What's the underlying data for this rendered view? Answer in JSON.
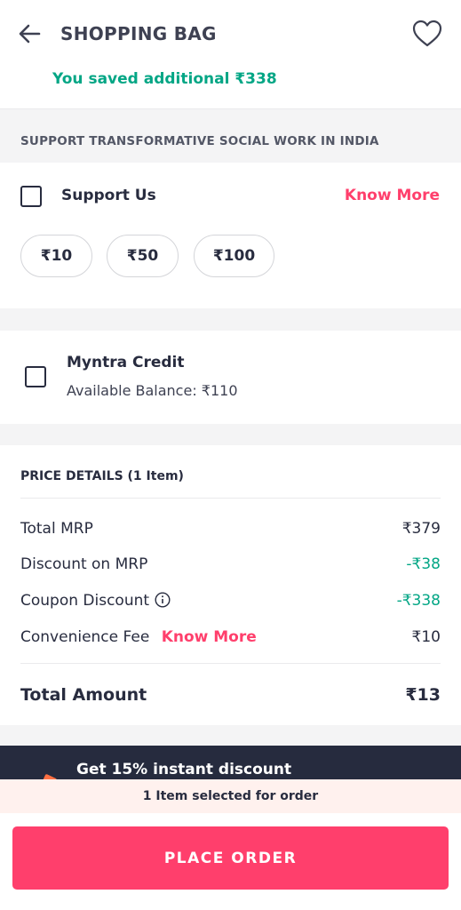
{
  "header": {
    "title": "SHOPPING BAG"
  },
  "savings": {
    "text": "You saved additional ₹338"
  },
  "support": {
    "heading": "SUPPORT TRANSFORMATIVE SOCIAL WORK IN INDIA",
    "label": "Support Us",
    "know_more": "Know More",
    "amounts": [
      "₹10",
      "₹50",
      "₹100"
    ]
  },
  "credit": {
    "title": "Myntra Credit",
    "balance": "Available Balance: ₹110"
  },
  "price_details": {
    "heading": "PRICE DETAILS (1 Item)",
    "rows": [
      {
        "label": "Total MRP",
        "value": "₹379"
      },
      {
        "label": "Discount on MRP",
        "value": "-₹38"
      },
      {
        "label": "Coupon Discount",
        "value": "-₹338"
      },
      {
        "label": "Convenience Fee",
        "link": "Know More",
        "value": "₹10"
      }
    ],
    "total_label": "Total Amount",
    "total_value": "₹13"
  },
  "offer": {
    "text": "Get 15% instant discount"
  },
  "selection": {
    "text": "1 Item selected for order"
  },
  "footer": {
    "button_label": "PLACE ORDER"
  },
  "colors": {
    "accent": "#ff3f6c",
    "success": "#03a685",
    "text": "#282c3f",
    "banner": "#262b3e"
  }
}
